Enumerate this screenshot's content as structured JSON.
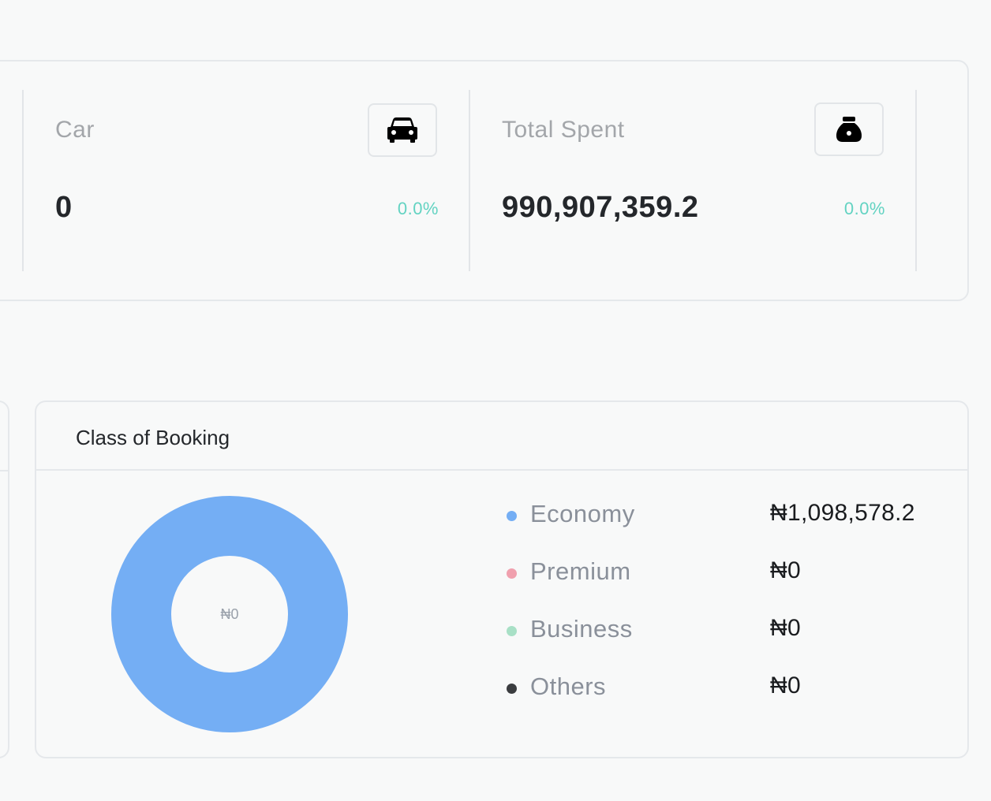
{
  "stats": [
    {
      "label": "Car",
      "value": "0",
      "change": "0.0%",
      "icon": "car-icon"
    },
    {
      "label": "Total Spent",
      "value": "990,907,359.2",
      "change": "0.0%",
      "icon": "money-bag-icon"
    }
  ],
  "booking": {
    "title": "Class of Booking",
    "center_label": "₦0",
    "legend": [
      {
        "label": "Economy",
        "value": "₦1,098,578.2",
        "color": "#74aef4"
      },
      {
        "label": "Premium",
        "value": "₦0",
        "color": "#f0a0ae"
      },
      {
        "label": "Business",
        "value": "₦0",
        "color": "#a8e0c6"
      },
      {
        "label": "Others",
        "value": "₦0",
        "color": "#3b3d40"
      }
    ]
  },
  "chart_data": {
    "type": "pie",
    "categories": [
      "Economy",
      "Premium",
      "Business",
      "Others"
    ],
    "values": [
      1098578.2,
      0,
      0,
      0
    ],
    "title": "Class of Booking"
  }
}
